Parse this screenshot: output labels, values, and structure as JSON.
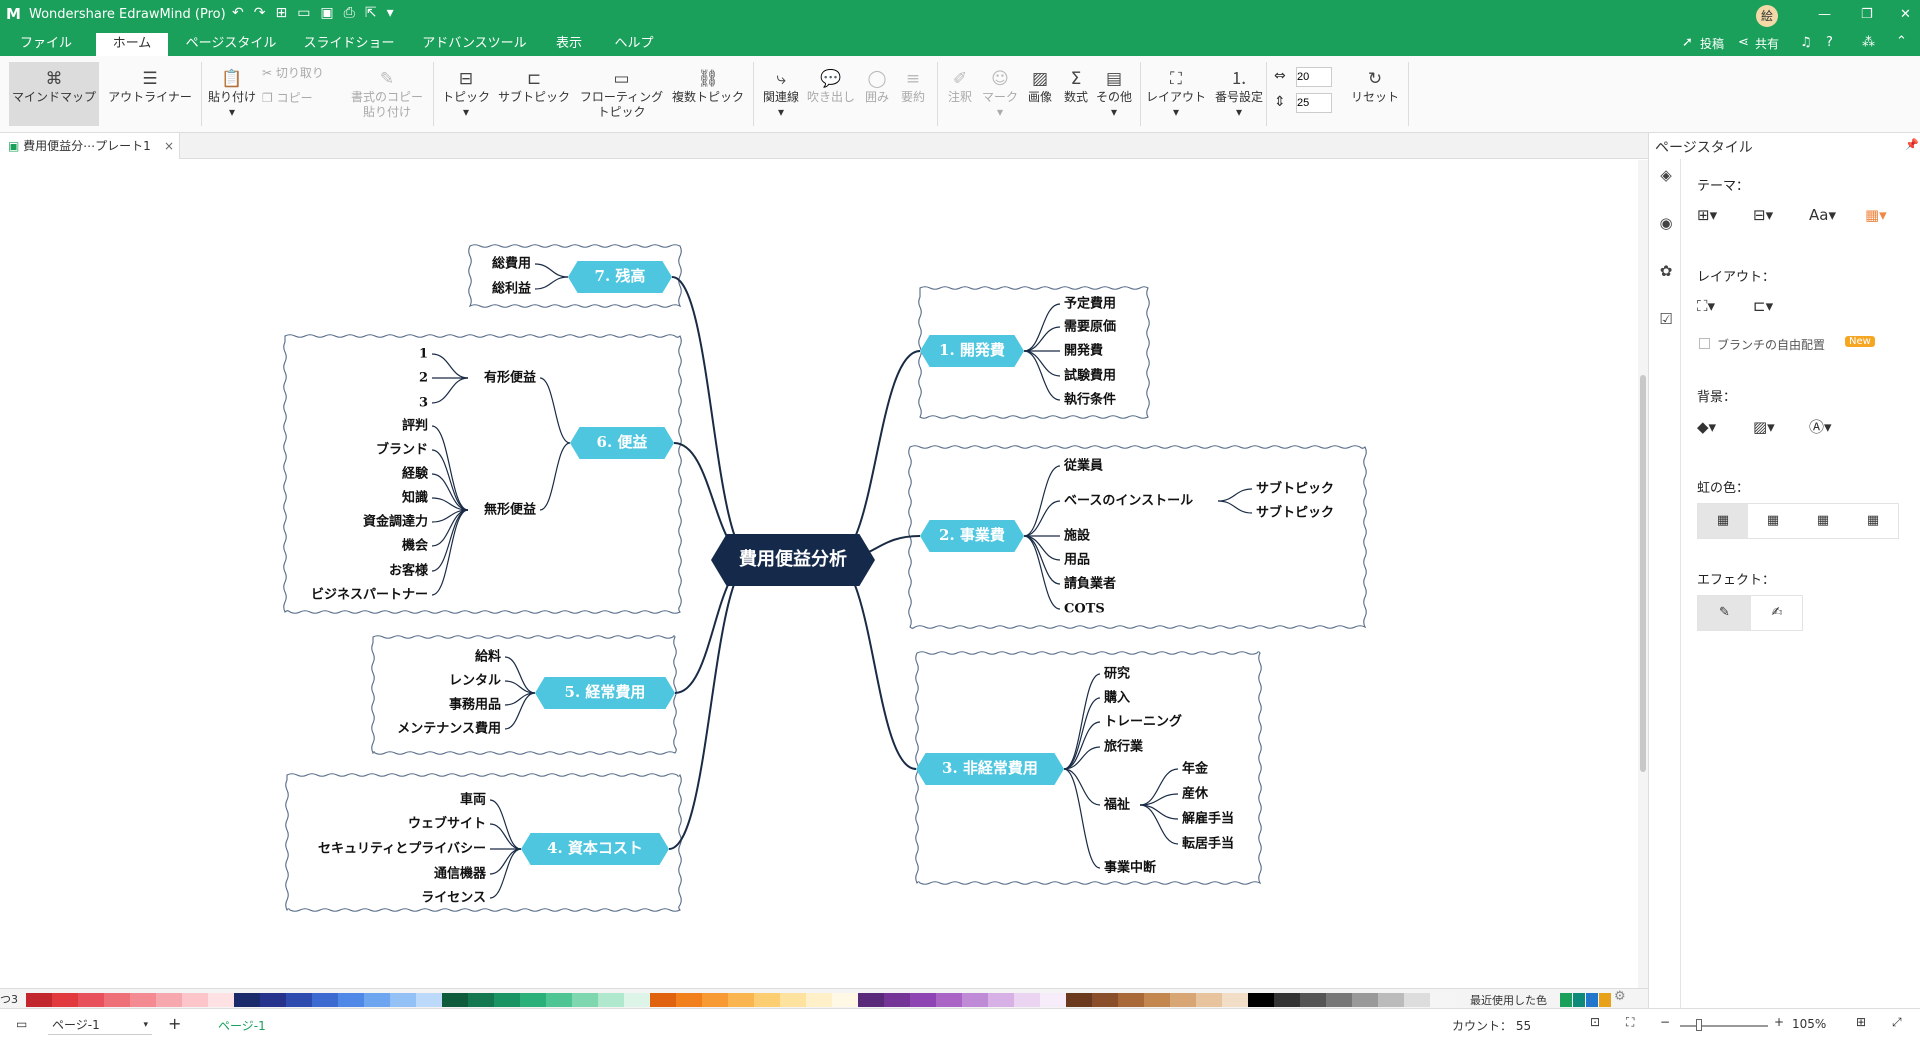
{
  "app": {
    "title": "Wondershare EdrawMind (Pro)",
    "avatar": "絵",
    "publish": "投稿",
    "share": "共有"
  },
  "menu": [
    "ファイル",
    "ホーム",
    "ページスタイル",
    "スライドショー",
    "アドバンスツール",
    "表示",
    "ヘルプ"
  ],
  "ribbon": {
    "mindmap": "マインドマップ",
    "outliner": "アウトライナー",
    "paste": "貼り付け",
    "cut": "切り取り",
    "copy": "コピー",
    "format_copy_1": "書式のコピー",
    "format_copy_2": "貼り付け",
    "topic": "トピック",
    "subtopic": "サブトピック",
    "floating_1": "フローティング",
    "floating_2": "トピック",
    "multi_topic": "複数トピック",
    "relation": "関連線",
    "callout": "吹き出し",
    "boundary": "囲み",
    "summary": "要約",
    "note": "注釈",
    "mark": "マーク",
    "image": "画像",
    "formula": "数式",
    "other": "その他",
    "layout": "レイアウト",
    "numbering": "番号設定",
    "width_val": "20",
    "height_val": "25",
    "reset": "リセット"
  },
  "doc_tab": "費用便益分⋯プレート1",
  "right_panel": {
    "title": "ページスタイル",
    "theme": "テーマ：",
    "layout": "レイアウト：",
    "free_branch": "ブランチの自由配置",
    "new_badge": "New",
    "background": "背景：",
    "rainbow": "虹の色：",
    "effect": "エフェクト："
  },
  "status": {
    "page_select": "ページ-1",
    "page_tab": "ページ-1",
    "count": "カウント： 55",
    "zoom": "105%",
    "recent_colors": "最近使用した色",
    "palette_left": "つ3"
  },
  "mindmap": {
    "center": "費用便益分析",
    "branches": {
      "b1": {
        "label": "1. 開発費",
        "children": [
          "予定費用",
          "需要原価",
          "開発費",
          "試験費用",
          "執行条件"
        ]
      },
      "b2": {
        "label": "2. 事業費",
        "children": [
          "従業員",
          "ベースのインストール",
          "施設",
          "用品",
          "請負業者",
          "COTS"
        ],
        "sub": [
          "サブトピック",
          "サブトピック"
        ]
      },
      "b3": {
        "label": "3. 非経常費用",
        "children": [
          "研究",
          "購入",
          "トレーニング",
          "旅行業",
          "福祉",
          "事業中断"
        ],
        "sub": [
          "年金",
          "産休",
          "解雇手当",
          "転居手当"
        ]
      },
      "b4": {
        "label": "4. 資本コスト",
        "children": [
          "車両",
          "ウェブサイト",
          "セキュリティとプライバシー",
          "通信機器",
          "ライセンス"
        ]
      },
      "b5": {
        "label": "5. 経常費用",
        "children": [
          "給料",
          "レンタル",
          "事務用品",
          "メンテナンス費用"
        ]
      },
      "b6": {
        "label": "6. 便益",
        "children": [
          "有形便益",
          "無形便益"
        ],
        "tangible": [
          "1",
          "2",
          "3"
        ],
        "intangible": [
          "評判",
          "ブランド",
          "経験",
          "知識",
          "資金調達力",
          "機会",
          "お客様",
          "ビジネスパートナー"
        ]
      },
      "b7": {
        "label": "7. 残高",
        "children": [
          "総費用",
          "総利益"
        ]
      }
    }
  },
  "colors": {
    "titlebar": "#1aa05a",
    "center_fill": "#15294a",
    "branch_fill": "#4ec6e0",
    "line": "#1a2b45"
  }
}
